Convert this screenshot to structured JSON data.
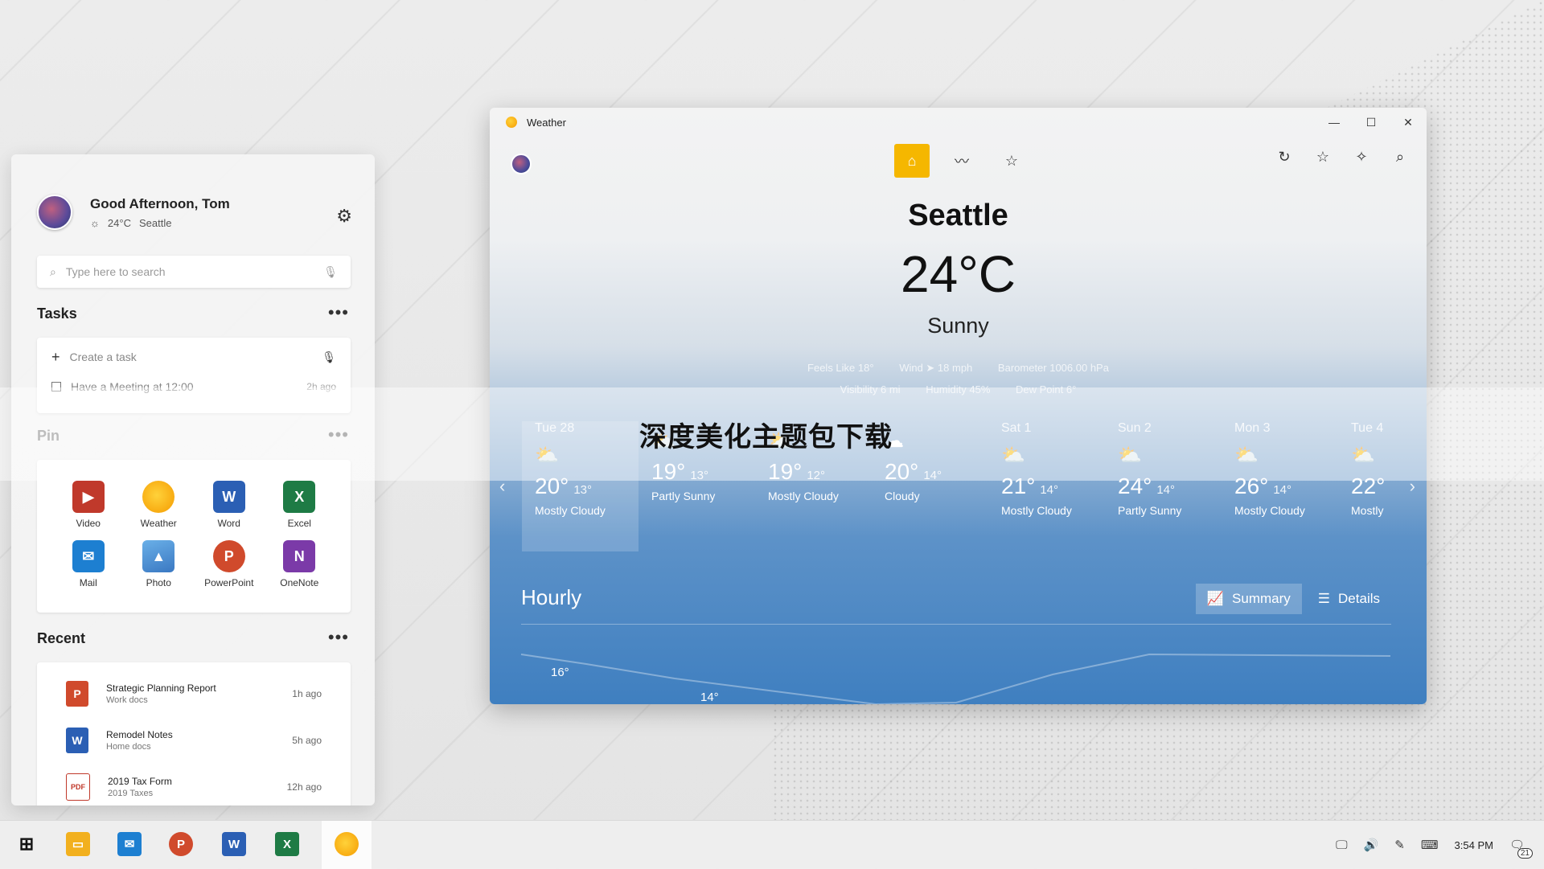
{
  "start_panel": {
    "greeting": "Good Afternoon, Tom",
    "weather_temp": "24°C",
    "weather_city": "Seattle",
    "search_placeholder": "Type here to search",
    "tasks": {
      "title": "Tasks",
      "create_placeholder": "Create a task",
      "items": [
        {
          "label": "Have a Meeting at 12:00",
          "time": "2h ago"
        }
      ]
    },
    "pin": {
      "title": "Pin",
      "apps": [
        {
          "label": "Video",
          "icon": "video-icon",
          "color": "#c0392b"
        },
        {
          "label": "Weather",
          "icon": "weather-icon",
          "color": "#f5a000"
        },
        {
          "label": "Word",
          "icon": "word-icon",
          "color": "#2b5fb4"
        },
        {
          "label": "Excel",
          "icon": "excel-icon",
          "color": "#1e7b45"
        },
        {
          "label": "Mail",
          "icon": "mail-icon",
          "color": "#1d7fd1"
        },
        {
          "label": "Photo",
          "icon": "photo-icon",
          "color": "#3a78c2"
        },
        {
          "label": "PowerPoint",
          "icon": "powerpoint-icon",
          "color": "#d04a2c"
        },
        {
          "label": "OneNote",
          "icon": "onenote-icon",
          "color": "#7b3aa8"
        }
      ]
    },
    "recent": {
      "title": "Recent",
      "items": [
        {
          "name": "Strategic Planning Report",
          "folder": "Work docs",
          "time": "1h ago",
          "icon": "powerpoint-icon",
          "glyph": "P",
          "color": "#d04a2c"
        },
        {
          "name": "Remodel Notes",
          "folder": "Home docs",
          "time": "5h ago",
          "icon": "word-icon",
          "glyph": "W",
          "color": "#2b5fb4"
        },
        {
          "name": "2019 Tax Form",
          "folder": "2019 Taxes",
          "time": "12h ago",
          "icon": "pdf-icon",
          "glyph": "PDF",
          "color": "#c0392b"
        }
      ]
    }
  },
  "weather": {
    "window_title": "Weather",
    "city": "Seattle",
    "temperature": "24°C",
    "condition": "Sunny",
    "stats": {
      "feels_like": "Feels Like  18°",
      "wind": "Wind  ➤ 18 mph",
      "barometer": "Barometer  1006.00 hPa",
      "visibility": "Visibility  6 mi",
      "humidity": "Humidity  45%",
      "dew_point": "Dew Point  6°"
    },
    "forecast": [
      {
        "day": "Tue 28",
        "high": "20°",
        "low": "13°",
        "cond": "Mostly Cloudy"
      },
      {
        "day": "",
        "high": "19°",
        "low": "13°",
        "cond": "Partly Sunny"
      },
      {
        "day": "",
        "high": "19°",
        "low": "12°",
        "cond": "Mostly Cloudy"
      },
      {
        "day": "",
        "high": "20°",
        "low": "14°",
        "cond": "Cloudy"
      },
      {
        "day": "Sat 1",
        "high": "21°",
        "low": "14°",
        "cond": "Mostly Cloudy"
      },
      {
        "day": "Sun 2",
        "high": "24°",
        "low": "14°",
        "cond": "Partly Sunny"
      },
      {
        "day": "Mon 3",
        "high": "26°",
        "low": "14°",
        "cond": "Mostly Cloudy"
      },
      {
        "day": "Tue 4",
        "high": "22°",
        "low": "",
        "cond": "Mostly C"
      }
    ],
    "hourly_title": "Hourly",
    "summary_label": "Summary",
    "details_label": "Details",
    "hourly_labels": [
      "16°",
      "14°"
    ]
  },
  "banner_text": "深度美化主题包下载",
  "taskbar": {
    "clock": "3:54 PM",
    "notification_count": "21",
    "apps": [
      {
        "icon": "start-icon"
      },
      {
        "icon": "file-explorer-icon"
      },
      {
        "icon": "mail-icon"
      },
      {
        "icon": "powerpoint-icon"
      },
      {
        "icon": "word-icon"
      },
      {
        "icon": "excel-icon"
      },
      {
        "icon": "weather-icon"
      }
    ]
  }
}
